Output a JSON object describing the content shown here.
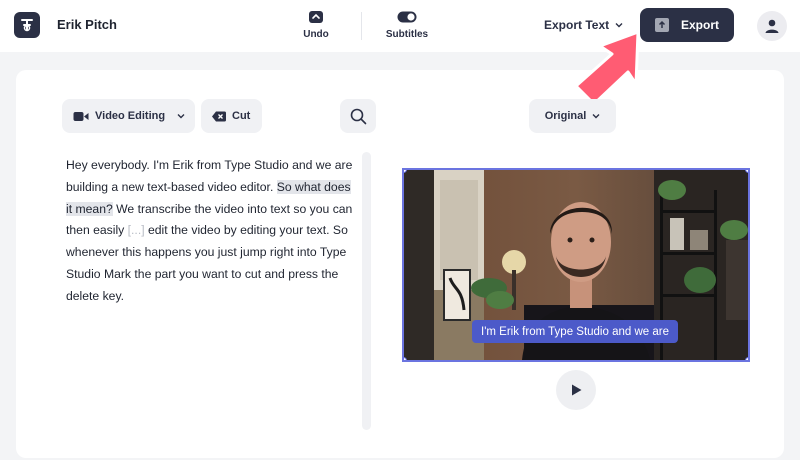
{
  "header": {
    "project_title": "Erik Pitch",
    "undo_label": "Undo",
    "subtitles_label": "Subtitles",
    "export_text_label": "Export Text",
    "export_label": "Export"
  },
  "toolbar": {
    "mode_label": "Video Editing",
    "cut_label": "Cut",
    "view_label": "Original"
  },
  "transcript": {
    "t1": "Hey everybody. I'm Erik from Type Studio and we are building a new text-based video editor. ",
    "t2": "So what does it mean?",
    "t3": " We transcribe the video into text so you can then easily ",
    "gap": "[...]",
    "t4": " edit the video by editing your text. So whenever this happens you just jump right into Type Studio Mark the part you want to cut and press the delete key."
  },
  "video": {
    "caption": "I'm Erik from Type Studio and we are"
  },
  "icons": [
    "app-logo-icon",
    "undo-icon",
    "subtitles-toggle-icon",
    "chevron-down-icon",
    "export-icon",
    "user-icon",
    "video-camera-icon",
    "cut-x-icon",
    "search-icon",
    "play-icon",
    "pointer-arrow"
  ],
  "colors": {
    "primary": "#2b3045",
    "accent_pink": "#ff5c73",
    "caption_bg": "#4c5ac9",
    "selection_border": "#6b74e0"
  }
}
